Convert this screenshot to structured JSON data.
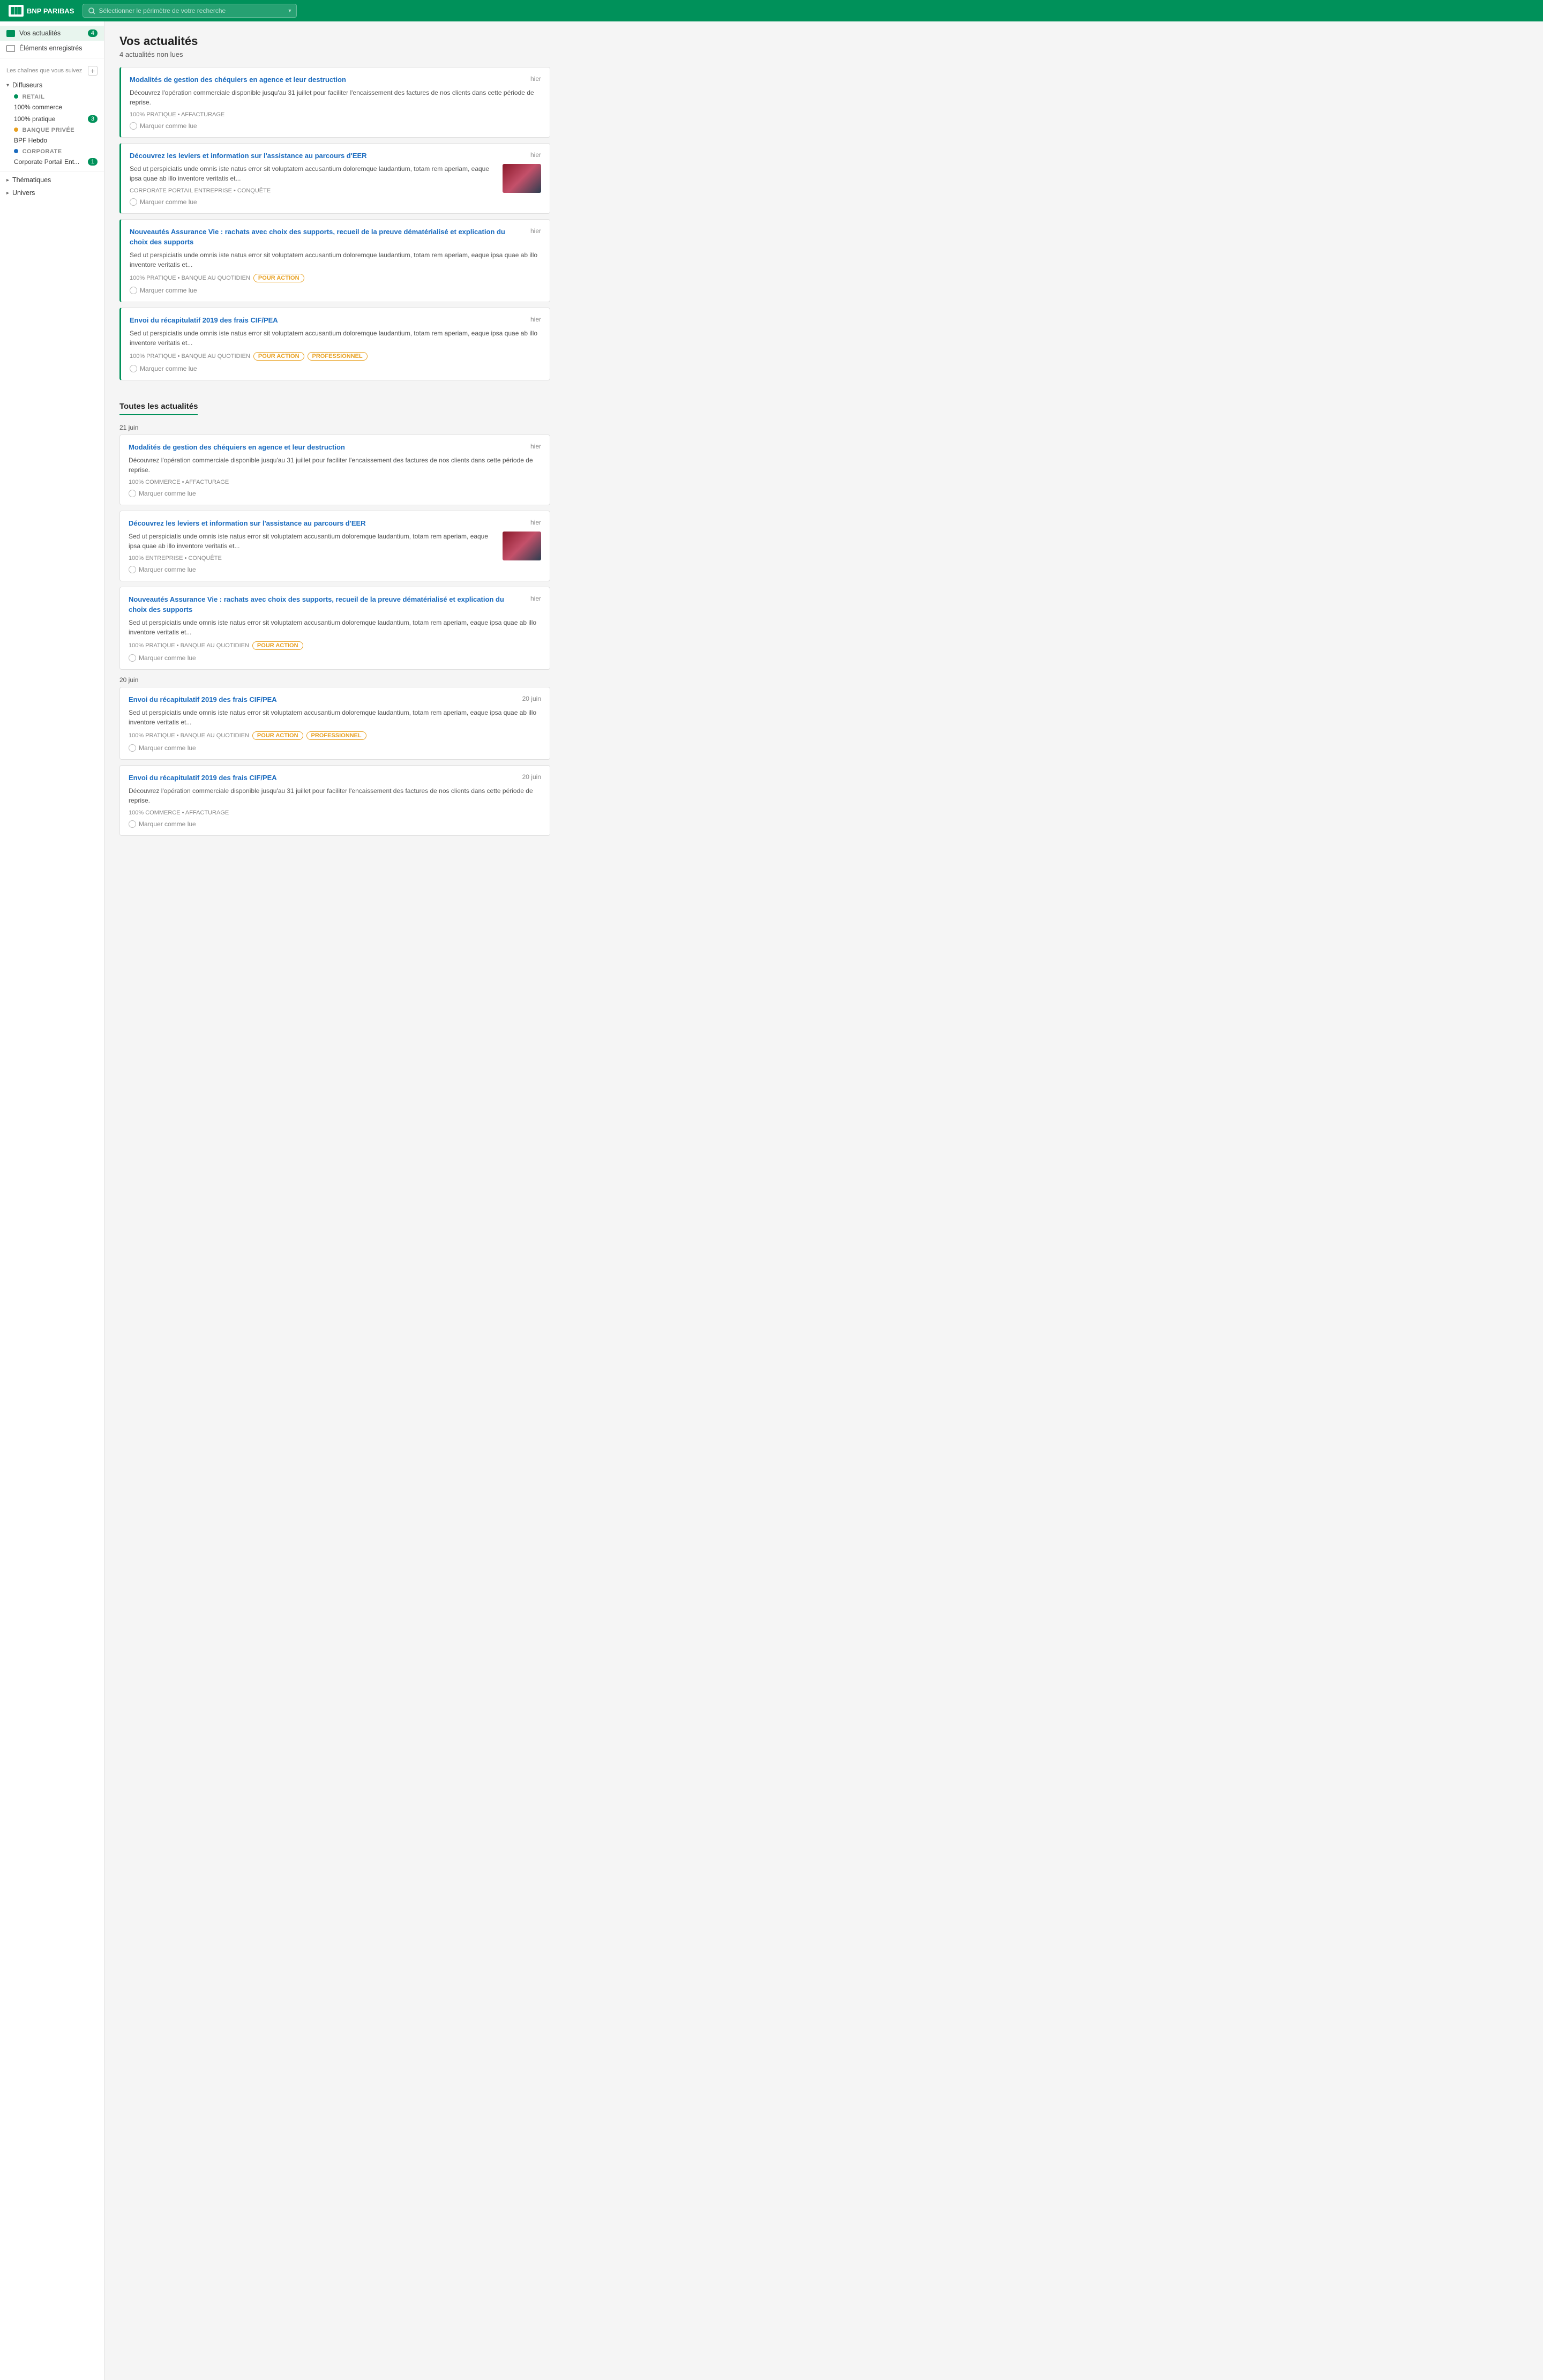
{
  "topnav": {
    "logo_text": "BNP PARIBAS",
    "search_placeholder": "Sélectionner le périmètre de votre recherche"
  },
  "sidebar": {
    "vos_actualites_label": "Vos actualités",
    "vos_actualites_badge": "4",
    "elements_enregistres_label": "Éléments enregistrés",
    "chaines_label": "Les chaînes que vous suivez",
    "diffuseurs_label": "Diffuseurs",
    "retail_label": "RETAIL",
    "retail_sub1": "100% commerce",
    "retail_sub2": "100% pratique",
    "retail_sub2_badge": "3",
    "banque_privee_label": "BANQUE PRIVÉE",
    "banque_privee_sub1": "BPF Hebdo",
    "corporate_label": "CORPORATE",
    "corporate_sub1": "Corporate Portail Ent...",
    "corporate_sub1_badge": "1",
    "thematiques_label": "Thématiques",
    "univers_label": "Univers"
  },
  "main": {
    "page_title": "Vos actualités",
    "unread_count": "4 actualités non lues",
    "section_all": "Toutes les actualités",
    "date_21_juin": "21 juin",
    "date_20_juin": "20 juin"
  },
  "unread_news": [
    {
      "title": "Modalités de gestion des chéquiers en agence et leur destruction",
      "date": "hier",
      "desc": "Découvrez l'opération commerciale disponible jusqu'au 31 juillet pour faciliter l'encaissement des factures de nos clients dans cette période de reprise.",
      "tags": "100% PRATIQUE • AFFACTURAGE",
      "badges": [],
      "has_thumb": false,
      "mark_read": "Marquer comme lue"
    },
    {
      "title": "Découvrez les leviers et information sur l'assistance au parcours d'EER",
      "date": "hier",
      "desc": "Sed ut perspiciatis unde omnis iste natus error sit voluptatem accusantium doloremque laudantium, totam rem aperiam, eaque ipsa quae ab illo inventore veritatis et...",
      "tags": "CORPORATE PORTAIL ENTREPRISE • CONQUÊTE",
      "badges": [],
      "has_thumb": true,
      "mark_read": "Marquer comme lue"
    },
    {
      "title": "Nouveautés Assurance Vie : rachats avec choix des supports, recueil de la preuve dématérialisé et explication du choix des supports",
      "date": "hier",
      "desc": "Sed ut perspiciatis unde omnis iste natus error sit voluptatem accusantium doloremque laudantium, totam rem aperiam, eaque ipsa quae ab illo inventore veritatis et...",
      "tags": "100% PRATIQUE • BANQUE AU QUOTIDIEN",
      "badges": [
        "POUR ACTION"
      ],
      "has_thumb": false,
      "mark_read": "Marquer comme lue"
    },
    {
      "title": "Envoi du récapitulatif 2019 des frais CIF/PEA",
      "date": "hier",
      "desc": "Sed ut perspiciatis unde omnis iste natus error sit voluptatem accusantium doloremque laudantium, totam rem aperiam, eaque ipsa quae ab illo inventore veritatis et...",
      "tags": "100% PRATIQUE • BANQUE AU QUOTIDIEN",
      "badges": [
        "POUR ACTION",
        "PROFESSIONNEL"
      ],
      "has_thumb": false,
      "mark_read": "Marquer comme lue"
    }
  ],
  "all_news_21": [
    {
      "title": "Modalités de gestion des chéquiers en agence et leur destruction",
      "date": "hier",
      "desc": "Découvrez l'opération commerciale disponible jusqu'au 31 juillet pour faciliter l'encaissement des factures de nos clients dans cette période de reprise.",
      "tags": "100% COMMERCE • AFFACTURAGE",
      "badges": [],
      "has_thumb": false,
      "mark_read": "Marquer comme lue"
    },
    {
      "title": "Découvrez les leviers et information sur l'assistance au parcours d'EER",
      "date": "hier",
      "desc": "Sed ut perspiciatis unde omnis iste natus error sit voluptatem accusantium doloremque laudantium, totam rem aperiam, eaque ipsa quae ab illo inventore veritatis et...",
      "tags": "100% ENTREPRISE • CONQUÊTE",
      "badges": [],
      "has_thumb": true,
      "mark_read": "Marquer comme lue"
    },
    {
      "title": "Nouveautés Assurance Vie : rachats avec choix des supports, recueil de la preuve dématérialisé et explication du choix des supports",
      "date": "hier",
      "desc": "Sed ut perspiciatis unde omnis iste natus error sit voluptatem accusantium doloremque laudantium, totam rem aperiam, eaque ipsa quae ab illo inventore veritatis et...",
      "tags": "100% PRATIQUE • BANQUE AU QUOTIDIEN",
      "badges": [
        "POUR ACTION"
      ],
      "has_thumb": false,
      "mark_read": "Marquer comme lue"
    }
  ],
  "all_news_20": [
    {
      "title": "Envoi du récapitulatif 2019 des frais CIF/PEA",
      "date": "20 juin",
      "desc": "Sed ut perspiciatis unde omnis iste natus error sit voluptatem accusantium doloremque laudantium, totam rem aperiam, eaque ipsa quae ab illo inventore veritatis et...",
      "tags": "100% PRATIQUE • BANQUE AU QUOTIDIEN",
      "badges": [
        "POUR ACTION",
        "PROFESSIONNEL"
      ],
      "has_thumb": false,
      "mark_read": "Marquer comme lue"
    },
    {
      "title": "Envoi du récapitulatif 2019 des frais CIF/PEA",
      "date": "20 juin",
      "desc": "Découvrez l'opération commerciale disponible jusqu'au 31 juillet pour faciliter l'encaissement des factures de nos clients dans cette période de reprise.",
      "tags": "100% COMMERCE • AFFACTURAGE",
      "badges": [],
      "has_thumb": false,
      "mark_read": "Marquer comme lue"
    }
  ]
}
